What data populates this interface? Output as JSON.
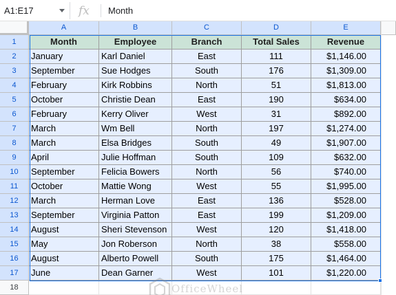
{
  "formula_bar": {
    "name_box": "A1:E17",
    "fx_label": "fx",
    "value": "Month"
  },
  "columns": [
    "A",
    "B",
    "C",
    "D",
    "E"
  ],
  "row_numbers": [
    "1",
    "2",
    "3",
    "4",
    "5",
    "6",
    "7",
    "8",
    "9",
    "10",
    "11",
    "12",
    "13",
    "14",
    "15",
    "16",
    "17",
    "18"
  ],
  "table": {
    "headers": [
      "Month",
      "Employee",
      "Branch",
      "Total Sales",
      "Revenue"
    ],
    "rows": [
      [
        "January",
        "Karl Daniel",
        "East",
        "111",
        "$1,146.00"
      ],
      [
        "September",
        "Sue Hodges",
        "South",
        "176",
        "$1,309.00"
      ],
      [
        "February",
        "Kirk Robbins",
        "North",
        "51",
        "$1,813.00"
      ],
      [
        "October",
        "Christie Dean",
        "East",
        "190",
        "$634.00"
      ],
      [
        "February",
        "Kerry Oliver",
        "West",
        "31",
        "$892.00"
      ],
      [
        "March",
        "Wm Bell",
        "North",
        "197",
        "$1,274.00"
      ],
      [
        "March",
        "Elsa Bridges",
        "South",
        "49",
        "$1,907.00"
      ],
      [
        "April",
        "Julie Hoffman",
        "South",
        "109",
        "$632.00"
      ],
      [
        "September",
        "Felicia Bowers",
        "North",
        "56",
        "$740.00"
      ],
      [
        "October",
        "Mattie Wong",
        "West",
        "55",
        "$1,995.00"
      ],
      [
        "March",
        "Herman Love",
        "East",
        "136",
        "$528.00"
      ],
      [
        "September",
        "Virginia Patton",
        "East",
        "199",
        "$1,209.00"
      ],
      [
        "August",
        "Sheri Stevenson",
        "West",
        "120",
        "$1,418.00"
      ],
      [
        "May",
        "Jon Roberson",
        "North",
        "38",
        "$558.00"
      ],
      [
        "August",
        "Alberto Powell",
        "South",
        "175",
        "$1,464.00"
      ],
      [
        "June",
        "Dean Garner",
        "West",
        "101",
        "$1,220.00"
      ]
    ]
  },
  "watermark": {
    "text": "OfficeWheel"
  },
  "colors": {
    "header_fill": "#cbe3d7",
    "row_fill": "#e6efff",
    "selection": "#1a73e8"
  }
}
